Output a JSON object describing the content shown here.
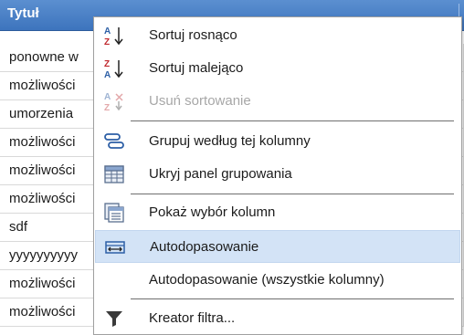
{
  "grid": {
    "header": "Tytuł",
    "rows": [
      "ponowne w",
      "możliwości",
      "umorzenia",
      "możliwości",
      "możliwości",
      "możliwości",
      "sdf",
      "yyyyyyyyyy",
      "możliwości",
      "możliwości"
    ]
  },
  "menu": {
    "items": [
      {
        "label": "Sortuj rosnąco",
        "icon": "sort-ascending-icon"
      },
      {
        "label": "Sortuj malejąco",
        "icon": "sort-descending-icon"
      },
      {
        "label": "Usuń sortowanie",
        "icon": "clear-sort-icon",
        "disabled": true
      },
      {
        "label": "Grupuj według tej kolumny",
        "icon": "group-by-column-icon"
      },
      {
        "label": "Ukryj panel grupowania",
        "icon": "group-panel-icon"
      },
      {
        "label": "Pokaż wybór kolumn",
        "icon": "column-chooser-icon"
      },
      {
        "label": "Autodopasowanie",
        "icon": "best-fit-icon",
        "highlighted": true
      },
      {
        "label": "Autodopasowanie (wszystkie kolumny)",
        "icon": ""
      },
      {
        "label": "Kreator filtra...",
        "icon": "filter-icon"
      }
    ]
  },
  "colors": {
    "header": "#3d74bd",
    "highlight": "#d3e3f6",
    "icon_blue": "#2d5fa6",
    "icon_red": "#c0282d"
  }
}
